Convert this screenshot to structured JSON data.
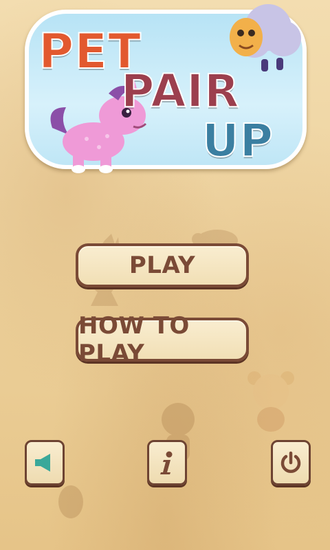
{
  "title": {
    "word1": "PET",
    "word2": "PAIR",
    "word3": "UP"
  },
  "menu": {
    "play_label": "PLAY",
    "how_to_play_label": "HOW TO PLAY"
  },
  "controls": [
    {
      "icon": "speaker-icon",
      "color": "#3aa89a"
    },
    {
      "icon": "info-icon",
      "color": "#7a4a36"
    },
    {
      "icon": "power-icon",
      "color": "#7a4a36"
    }
  ],
  "colors": {
    "background": "#f1d9a6",
    "button_text": "#7a4a36",
    "title_pet": "#e2592f",
    "title_pair": "#9c3f4e",
    "title_up": "#3b7fa1"
  }
}
